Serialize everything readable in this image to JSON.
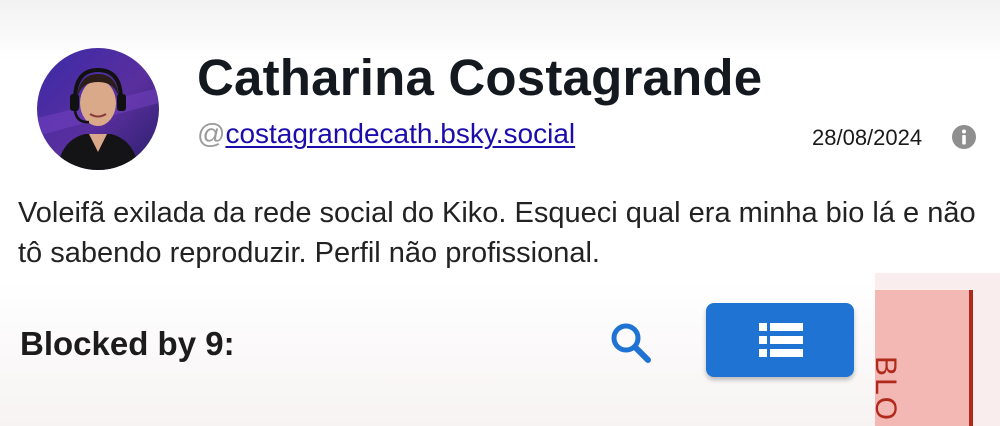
{
  "profile": {
    "display_name": "Catharina Costagrande",
    "handle_prefix": "@",
    "handle": "costagrandecath.bsky.social",
    "date": "28/08/2024",
    "bio": "Voleifã exilada da rede social do Kiko. Esqueci qual era minha bio lá e não tô sabendo reproduzir. Perfil não profissional."
  },
  "icons": {
    "info": "info-circle-icon",
    "search": "search-icon",
    "list": "list-icon"
  },
  "blocked": {
    "title": "Blocked by 9:"
  },
  "side_tab": {
    "label": "BLO"
  },
  "colors": {
    "link": "#1a0dab",
    "primary_button": "#1f73d2",
    "search_icon": "#1f73d2",
    "side_tab_bg": "#f3b8b3",
    "side_tab_accent": "#b02a1c"
  }
}
